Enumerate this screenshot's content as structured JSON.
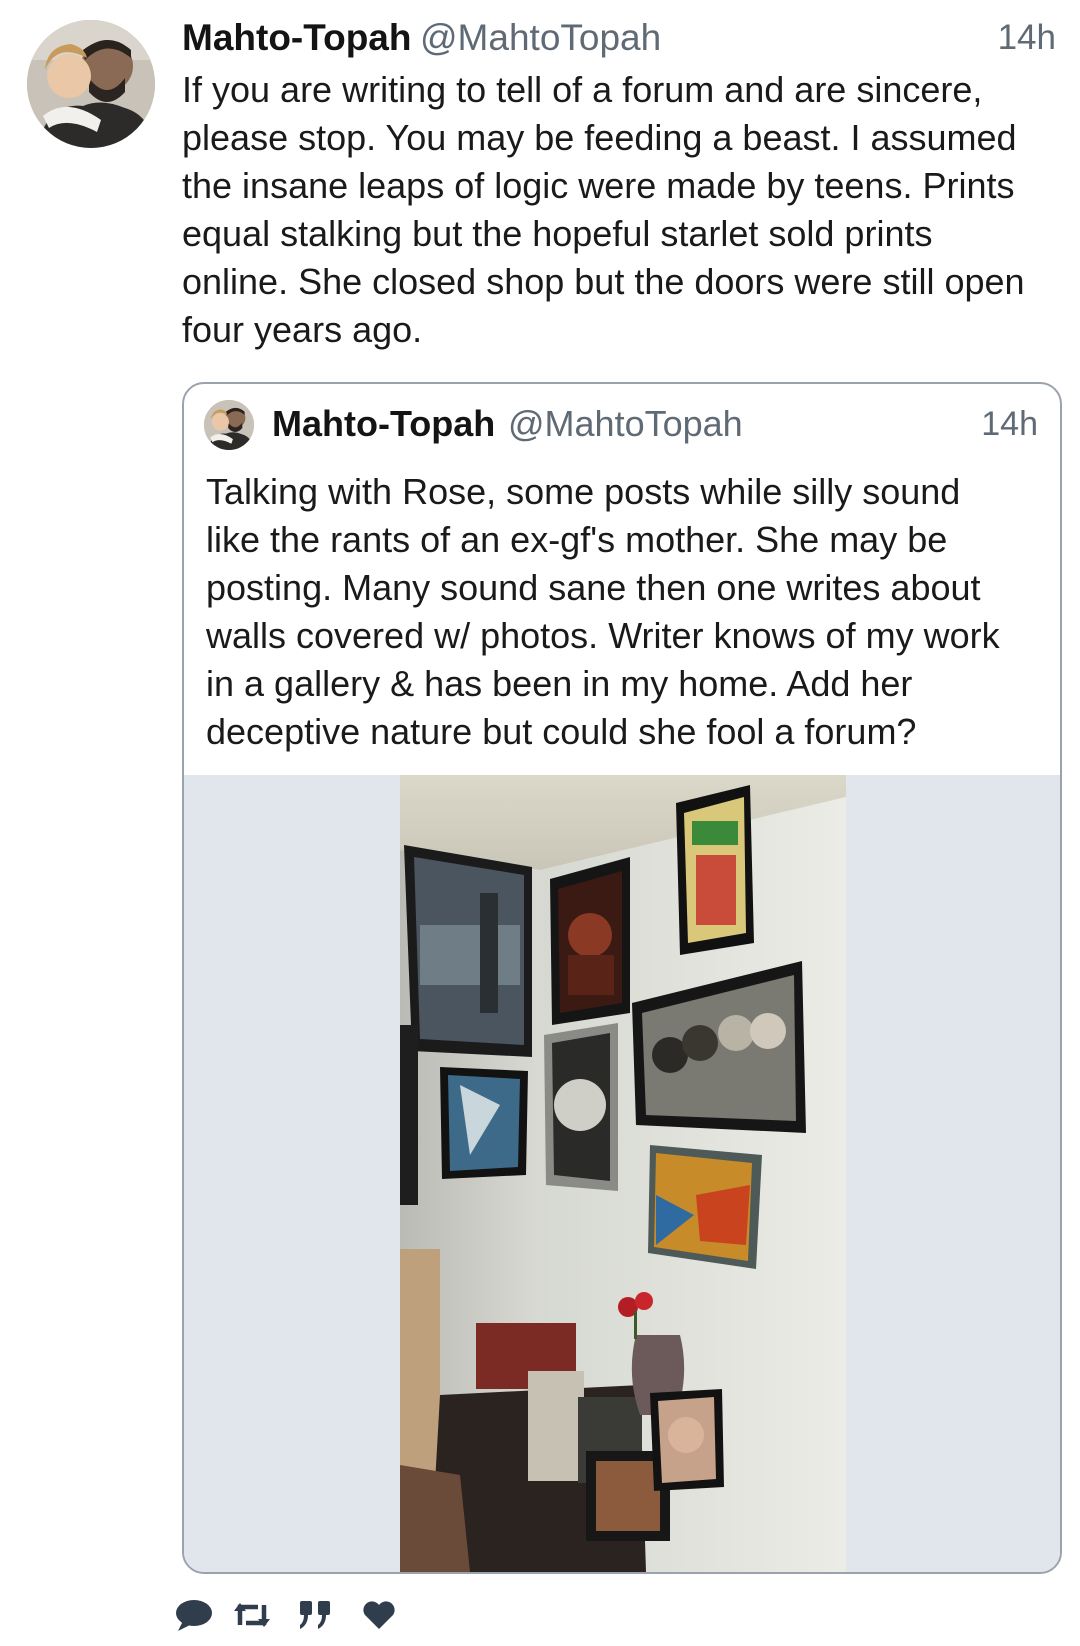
{
  "tweet": {
    "author_name": "Mahto-Topah",
    "author_handle": "@MahtoTopah",
    "time": "14h",
    "text_lines": [
      "If you are writing to tell of a forum and are sincere,",
      "please stop. You may be feeding a beast. I assumed",
      "the insane leaps of logic were made by teens. Prints",
      "equal stalking but the hopeful starlet sold prints",
      "online. She closed shop but the doors were still open",
      "four years ago."
    ]
  },
  "quoted": {
    "author_name": "Mahto-Topah",
    "author_handle": "@MahtoTopah",
    "time": "14h",
    "text_lines": [
      "Talking with Rose, some posts while silly sound",
      "like the rants of an ex-gf's mother. She may be",
      "posting. Many sound sane then one writes about",
      "walls covered w/ photos. Writer knows of my work",
      "in a gallery & has been in my home. Add her",
      "deceptive nature but could she fool a forum?"
    ]
  },
  "actions": [
    {
      "icon": "reply-icon"
    },
    {
      "icon": "retweet-icon"
    },
    {
      "icon": "quote-icon"
    },
    {
      "icon": "like-icon"
    }
  ],
  "colors": {
    "muted": "#5f6a75",
    "border": "#9aa3ad",
    "media_bg": "#e1e6ed",
    "icon": "#2f3d4c"
  }
}
